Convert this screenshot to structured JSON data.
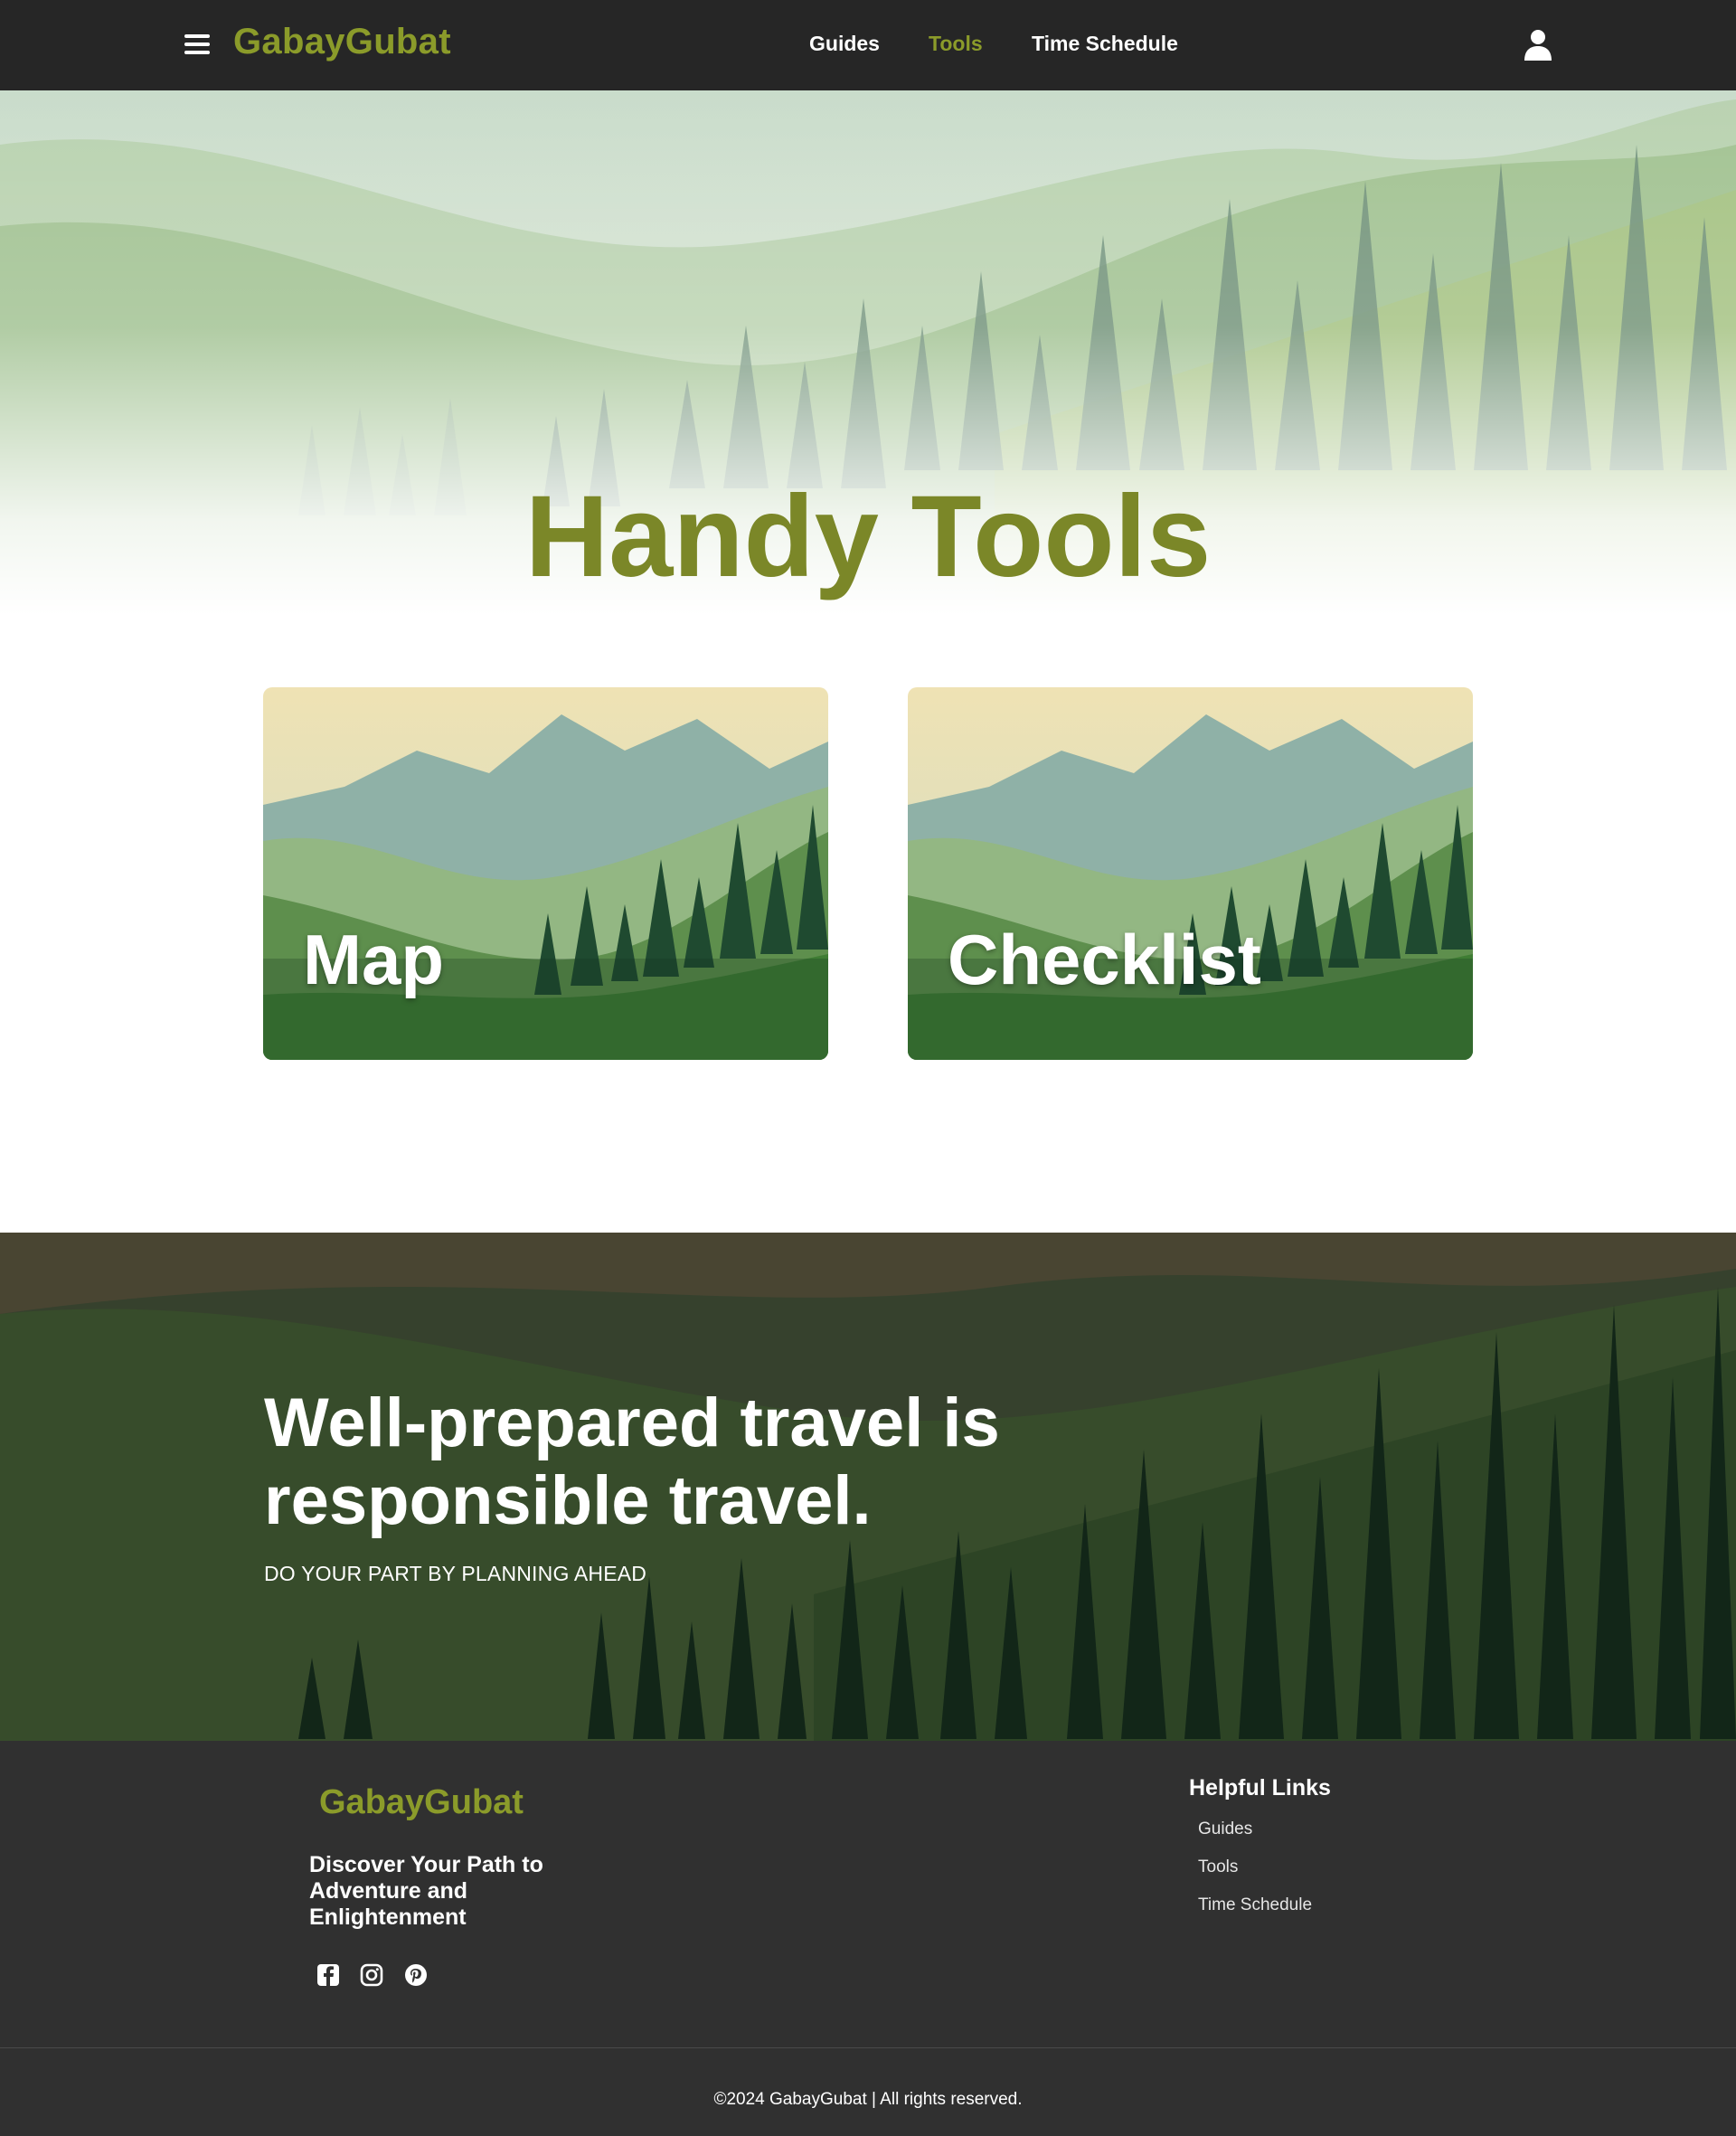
{
  "nav": {
    "brand": "GabayGubat",
    "links": [
      {
        "label": "Guides",
        "active": false
      },
      {
        "label": "Tools",
        "active": true
      },
      {
        "label": "Time Schedule",
        "active": false
      }
    ]
  },
  "hero": {
    "title": "Handy Tools"
  },
  "cards": [
    {
      "label": "Map"
    },
    {
      "label": "Checklist"
    }
  ],
  "banner": {
    "title": "Well-prepared travel is responsible travel.",
    "subtitle": "DO YOUR PART BY PLANNING AHEAD"
  },
  "footer": {
    "brand": "GabayGubat",
    "tagline": "Discover Your Path to Adventure and Enlightenment",
    "social": [
      "facebook-icon",
      "instagram-icon",
      "pinterest-icon"
    ],
    "links_title": "Helpful Links",
    "links": [
      "Guides",
      "Tools",
      "Time Schedule"
    ],
    "copyright": "©2024 GabayGubat | All rights reserved."
  },
  "colors": {
    "brand": "#8b9b2a",
    "title": "#7b8728",
    "nav_bg": "#262626",
    "footer_bg": "#303030"
  }
}
